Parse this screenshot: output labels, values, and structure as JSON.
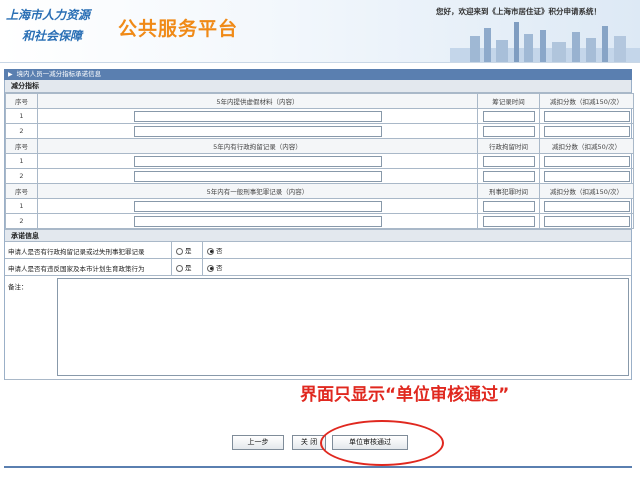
{
  "header": {
    "org_line1": "上海市人力资源",
    "org_line2": "和社会保障",
    "portal_title": "公共服务平台",
    "welcome": "您好，欢迎来到《上海市居住证》积分申请系统！"
  },
  "section_title": "境内人员一减分指标承诺信息",
  "deduct": {
    "heading": "减分指标",
    "groups": [
      {
        "col_no": "序号",
        "col_content": "5年内提供虚假材料（内容）",
        "col_time": "筹记录时间",
        "col_score": "减扣分数（扣减150/次）",
        "rows": [
          "1",
          "2"
        ]
      },
      {
        "col_no": "序号",
        "col_content": "5年内有行政拘留记录（内容）",
        "col_time": "行政拘留时间",
        "col_score": "减扣分数（扣减50/次）",
        "rows": [
          "1",
          "2"
        ]
      },
      {
        "col_no": "序号",
        "col_content": "5年内有一般刑事犯罪记录（内容）",
        "col_time": "刑事犯罪时间",
        "col_score": "减扣分数（扣减150/次）",
        "rows": [
          "1",
          "2"
        ]
      }
    ]
  },
  "promise": {
    "heading": "承诺信息",
    "questions": [
      {
        "text": "申请人是否有行政拘留记录或过失刑事犯罪记录",
        "yes": "是",
        "no": "否",
        "selected": "否"
      },
      {
        "text": "申请人是否有违反国家及本市计划生育政策行为",
        "yes": "是",
        "no": "否",
        "selected": "否"
      }
    ],
    "remark_label": "备注："
  },
  "annotation": "界面只显示“单位审核通过”",
  "buttons": {
    "prev": "上一步",
    "close": "关 闭",
    "approve": "单位审核通过"
  },
  "colors": {
    "accent_blue": "#5a7fb0",
    "brand_orange": "#f08a17",
    "annotation_red": "#e0281f"
  }
}
